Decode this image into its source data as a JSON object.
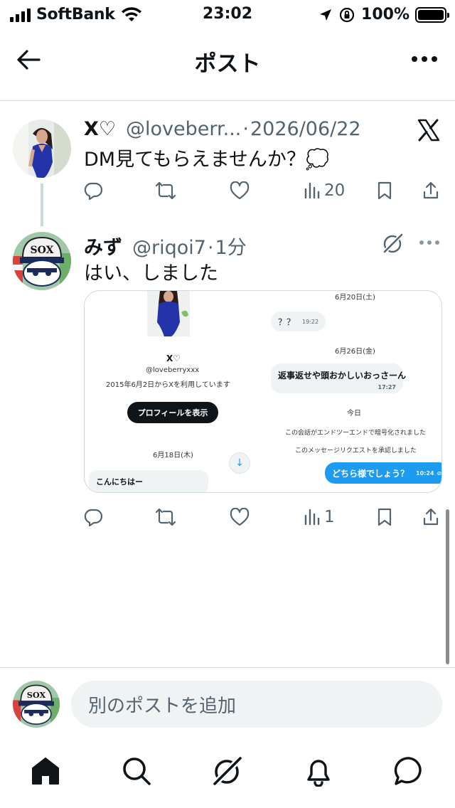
{
  "status_bar": {
    "carrier": "SoftBank",
    "time": "23:02",
    "battery": "100%"
  },
  "header": {
    "title": "ポスト"
  },
  "posts": [
    {
      "display_name": "X♡",
      "handle": "@loveberr...",
      "separator": "·",
      "timestamp": "2026/06/22",
      "text": "DM見てもらえませんか？💭",
      "source_icon": "x-logo-icon",
      "stats": {
        "views": "20"
      }
    },
    {
      "display_name": "みず",
      "handle": "@riqoi7",
      "separator": "·",
      "timestamp": "1分",
      "text": "はい、しました",
      "stats": {
        "views": "1"
      },
      "media": {
        "date1": "6月20日(土)",
        "msg1": "？？",
        "msg1_time": "19:22",
        "date2": "6月26日(金)",
        "msg2": "返事返せや頭おかしいおっさーん",
        "msg2_time": "17:27",
        "today": "今日",
        "e2e_notice": "この会話がエンドツーエンドで暗号化されました",
        "accepted_notice": "このメッセージリクエストを承認しました",
        "msg3": "どちら様でしょう？",
        "msg3_time": "10:24",
        "profile_name": "X♡",
        "profile_handle": "@loveberryxxx",
        "profile_since": "2015年6月2日からXを利用しています",
        "profile_button": "プロフィールを表示",
        "date3": "6月18日(木)",
        "msg0": "こんにちはー"
      }
    }
  ],
  "composer": {
    "placeholder": "別のポストを追加"
  },
  "colors": {
    "text": "#0f1419",
    "secondary": "#536471",
    "accent": "#1d9bf0",
    "bubble": "#eff3f4"
  },
  "tabbar": {
    "items": [
      "home-icon",
      "search-icon",
      "grok-icon",
      "notifications-icon",
      "messages-icon"
    ]
  }
}
